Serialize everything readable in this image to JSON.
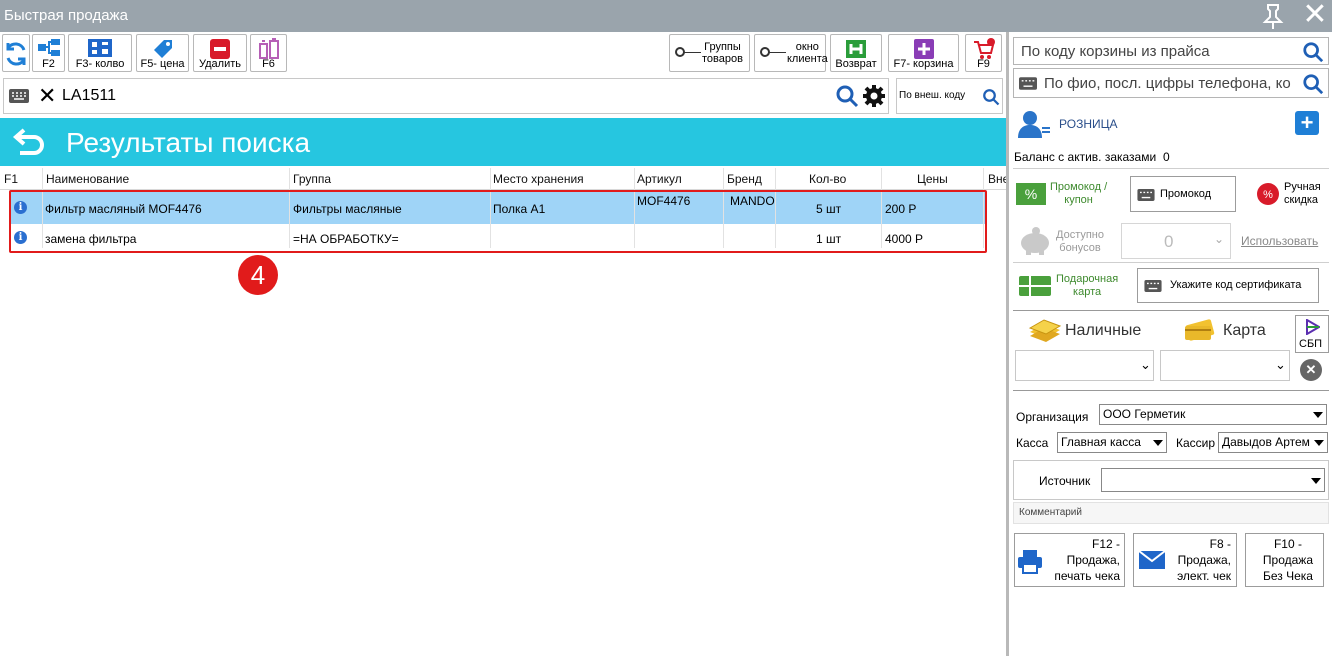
{
  "window": {
    "title": "Быстрая продажа"
  },
  "toolbar": {
    "f2": "F2",
    "f3": "F3- колво",
    "f5": "F5- цена",
    "delete": "Удалить",
    "f6": "F6",
    "groups": "Группы\nтоваров",
    "client": "окно\nклиента",
    "return": "Возврат",
    "f7": "F7- корзина",
    "f9": "F9"
  },
  "search": {
    "value": "LA1511",
    "ext_placeholder": "По внеш. коду"
  },
  "results": {
    "title": "Результаты поиска",
    "columns": [
      "F1",
      "Наименование",
      "Группа",
      "Место хранения",
      "Артикул",
      "Бренд",
      "Кол-во",
      "Цены",
      "Вне"
    ],
    "rows": [
      {
        "name": "Фильтр масляный MOF4476",
        "group": "Фильтры масляные",
        "storage": "Полка А1",
        "article": "MOF4476",
        "brand": "MANDO",
        "qty": "5 шт",
        "price": "200 Р"
      },
      {
        "name": "замена фильтра",
        "group": "=НА ОБРАБОТКУ=",
        "storage": "",
        "article": "",
        "brand": "",
        "qty": "1 шт",
        "price": "4000 Р"
      }
    ],
    "marker": "4"
  },
  "right": {
    "basket_placeholder": "По коду корзины из прайса",
    "client_placeholder": "По фио, посл. цифры телефона, ко",
    "customer": "РОЗНИЦА",
    "balance_label": "Баланс с актив. заказами",
    "balance_value": "0",
    "promo_label": "Промокод /\nкупон",
    "promo_btn": "Промокод",
    "manual_discount": "Ручная\nскидка",
    "bonus_label": "Доступно\nбонусов",
    "bonus_value": "0",
    "use_link": "Использовать",
    "gift_label": "Подарочная\nкарта",
    "cert_btn": "Укажите код сертификата",
    "cash": "Наличные",
    "card": "Карта",
    "sbp": "СБП",
    "org_label": "Организация",
    "org_value": "ООО Герметик",
    "kassa_label": "Касса",
    "kassa_value": "Главная касса",
    "cashier_label": "Кассир",
    "cashier_value": "Давыдов Артем",
    "source_label": "Источник",
    "comment_label": "Комментарий",
    "f12": "F12 -\nПродажа,\nпечать чека",
    "f8": "F8 -\nПродажа,\nэлект. чек",
    "f10": "F10 -\nПродажа\nБез Чека"
  },
  "colors": {
    "accent": "#26c6e0",
    "selected_row": "#9fd4f7",
    "marker_red": "#e11b1b",
    "titlebar": "#9aa4ac"
  }
}
